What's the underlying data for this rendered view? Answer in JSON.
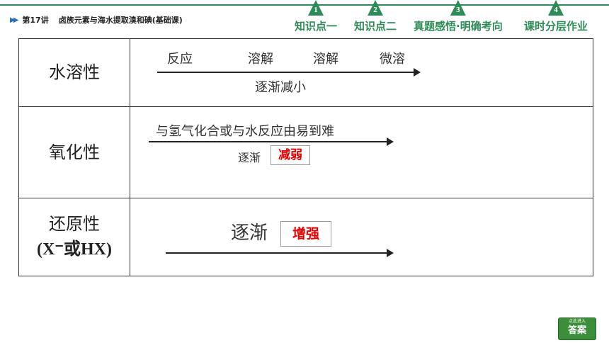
{
  "header": {
    "lesson_no": "第17讲",
    "lesson_topic": "卤族元素与海水提取溴和碘(基础课)",
    "tabs": [
      {
        "num": "1",
        "label": "知识点一"
      },
      {
        "num": "2",
        "label": "知识点二"
      },
      {
        "num": "3",
        "label": "真题感悟·明确考向"
      },
      {
        "num": "4",
        "label": "课时分层作业"
      }
    ]
  },
  "table": {
    "rows": [
      {
        "label": "水溶性",
        "items": [
          "反应",
          "溶解",
          "溶解",
          "微溶"
        ],
        "trend": "逐渐减小"
      },
      {
        "label": "氧化性",
        "caption": "与氢气化合或与水反应由易到难",
        "trend_prefix": "逐渐",
        "answer": "减弱"
      },
      {
        "label_line1": "还原性",
        "label_line2": "(X⁻或HX)",
        "trend_prefix": "逐渐",
        "answer": "增强"
      }
    ]
  },
  "answer_button": {
    "small": "点此进入",
    "main": "答案"
  }
}
